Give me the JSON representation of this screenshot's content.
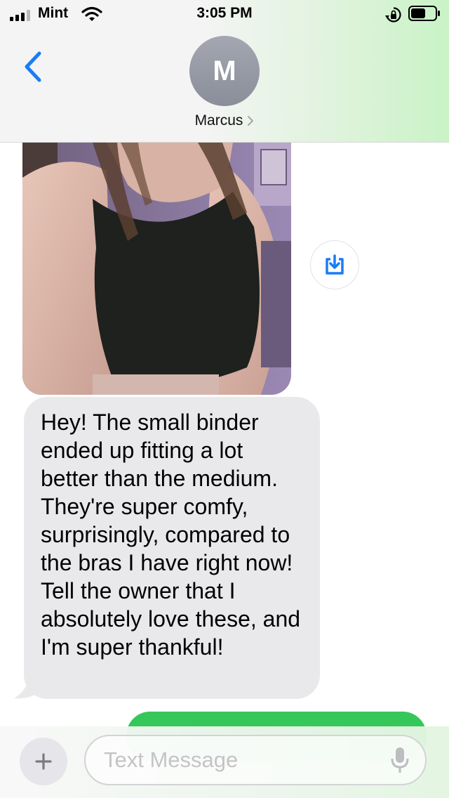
{
  "status_bar": {
    "carrier": "Mint",
    "time": "3:05 PM",
    "icons": [
      "signal-icon",
      "wifi-icon",
      "orientation-lock-icon",
      "battery-icon"
    ]
  },
  "header": {
    "back_icon": "chevron-left-icon",
    "avatar_initial": "M",
    "contact_name": "Marcus",
    "contact_chevron_icon": "chevron-right-icon"
  },
  "messages": {
    "photo": {
      "download_icon": "download-icon"
    },
    "received_text": "Hey! The small binder ended up fitting a lot better than the medium. They're super comfy, surprisingly, compared to the bras I have right now! Tell the owner that I absolutely love these, and I'm super thankful!"
  },
  "composer": {
    "plus_icon": "plus-icon",
    "placeholder": "Text Message",
    "value": "",
    "mic_icon": "microphone-icon"
  },
  "colors": {
    "accent_blue": "#1a7cf5",
    "bubble_received": "#e9e9eb",
    "bubble_sent": "#35c759",
    "avatar_gray": "#9a9da7"
  }
}
